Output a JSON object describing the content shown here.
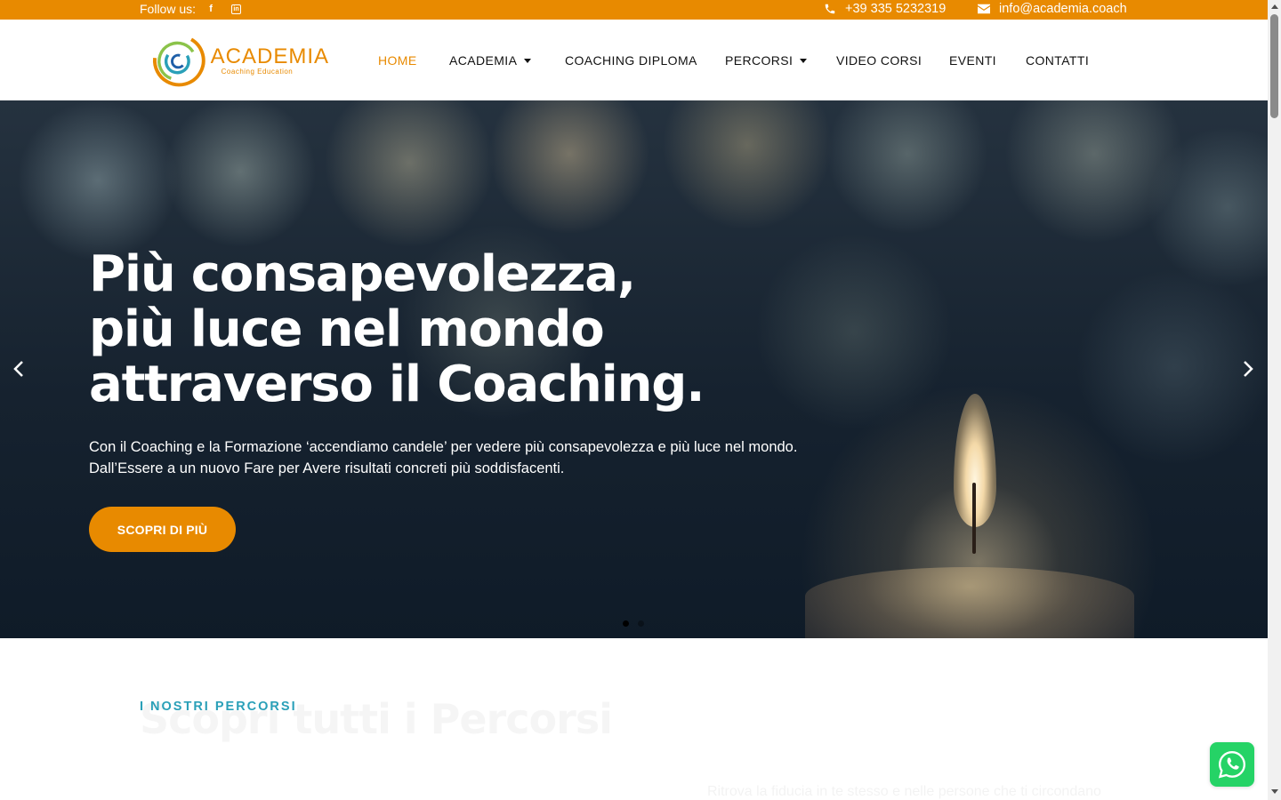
{
  "topbar": {
    "follow_label": "Follow us:",
    "social": [
      {
        "icon": "facebook-icon",
        "glyph": "f"
      },
      {
        "icon": "linkedin-icon",
        "glyph": "in"
      }
    ],
    "phone": "+39 335 5232319",
    "email": "info@academia.coach",
    "bg_color": "#e88a00"
  },
  "header": {
    "logo_title": "ACADEMIA",
    "logo_subtitle": "Coaching Education",
    "nav": [
      {
        "label": "HOME",
        "active": true,
        "dropdown": false
      },
      {
        "label": "ACADEMIA",
        "active": false,
        "dropdown": true
      },
      {
        "label": "COACHING DIPLOMA",
        "active": false,
        "dropdown": false
      },
      {
        "label": "PERCORSI",
        "active": false,
        "dropdown": true
      },
      {
        "label": "VIDEO CORSI",
        "active": false,
        "dropdown": false
      },
      {
        "label": "EVENTI",
        "active": false,
        "dropdown": false
      },
      {
        "label": "CONTATTI",
        "active": false,
        "dropdown": false
      }
    ]
  },
  "hero": {
    "title_lines": [
      "Più consapevolezza,",
      "più luce nel mondo",
      "attraverso il Coaching."
    ],
    "description": "Con il Coaching e la Formazione ‘accendiamo candele’ per vedere più consapevolezza e più luce nel mondo. Dall’Essere a un nuovo Fare per Avere risultati concreti più soddisfacenti.",
    "button_label": "SCOPRI DI PIÙ",
    "prev_icon": "chevron-left-icon",
    "next_icon": "chevron-right-icon",
    "slides_count": 2,
    "active_slide": 1
  },
  "section": {
    "label": "I NOSTRI PERCORSI",
    "title": "Scopri tutti i Percorsi",
    "text": "Ritrova la fiducia in te stesso e nelle persone che ti circondano"
  },
  "colors": {
    "accent": "#e88a00",
    "teal": "#2aa0b8",
    "whatsapp": "#25d366"
  }
}
